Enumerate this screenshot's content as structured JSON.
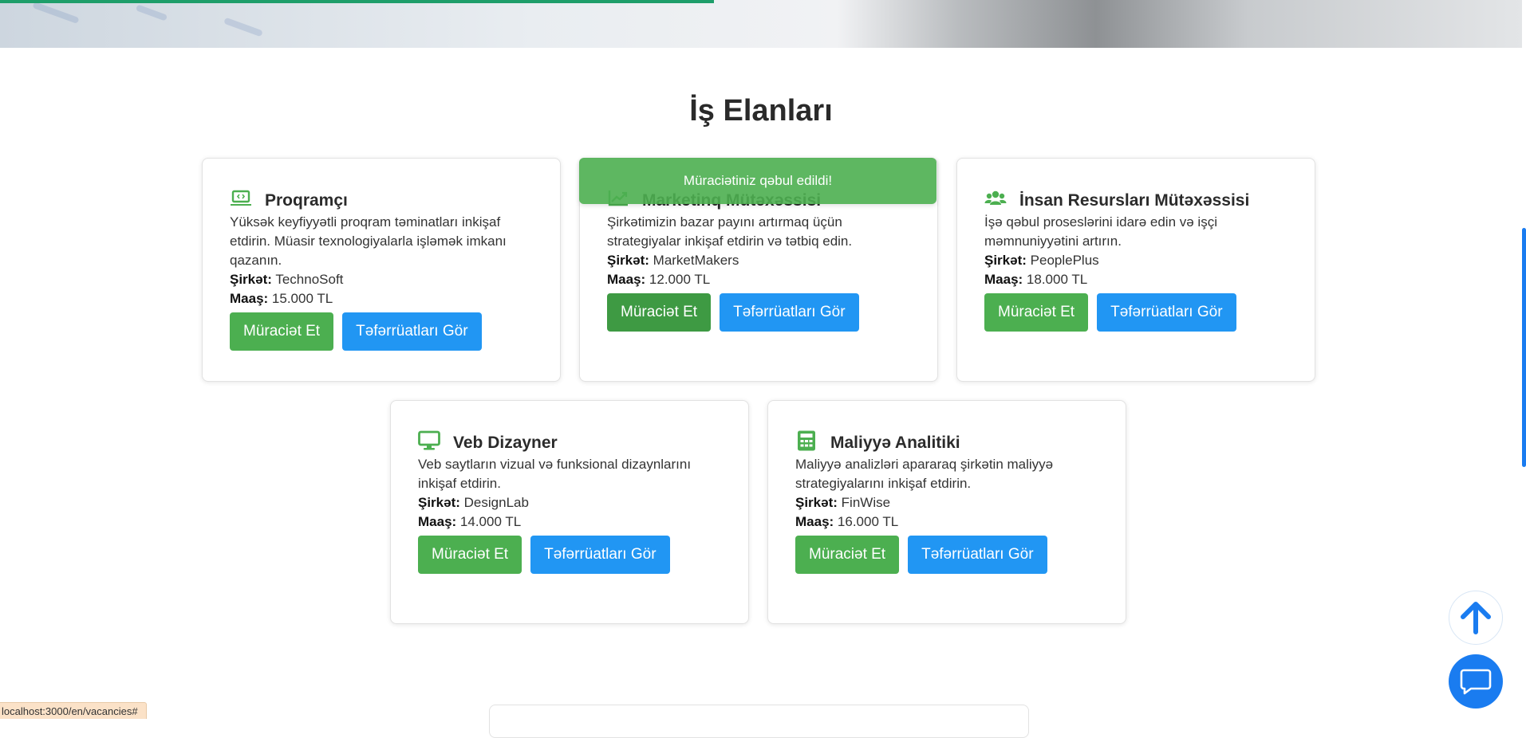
{
  "section": {
    "title": "İş Elanları"
  },
  "toast": {
    "message": "Müraciətiniz qəbul edildi!"
  },
  "labels": {
    "company": "Şirkət:",
    "salary": "Maaş:"
  },
  "buttons": {
    "apply": "Müraciət Et",
    "details": "Təfərrüatları Gör"
  },
  "jobs": [
    {
      "icon": "laptop-code-icon",
      "title": "Proqramçı",
      "description": "Yüksək keyfiyyətli proqram təminatları inkişaf etdirin. Müasir texnologiyalarla işləmək imkanı qazanın.",
      "company": "TechnoSoft",
      "salary": "15.000 TL"
    },
    {
      "icon": "chart-line-icon",
      "title": "Marketinq Mütəxəssisi",
      "description": "Şirkətimizin bazar payını artırmaq üçün strategiyalar inkişaf etdirin və tətbiq edin.",
      "company": "MarketMakers",
      "salary": "12.000 TL"
    },
    {
      "icon": "users-icon",
      "title": "İnsan Resursları Mütəxəssisi",
      "description": "İşə qəbul proseslərini idarə edin və işçi məmnuniyyətini artırın.",
      "company": "PeoplePlus",
      "salary": "18.000 TL"
    },
    {
      "icon": "desktop-icon",
      "title": "Veb Dizayner",
      "description": "Veb saytların vizual və funksional dizaynlarını inkişaf etdirin.",
      "company": "DesignLab",
      "salary": "14.000 TL"
    },
    {
      "icon": "calculator-icon",
      "title": "Maliyyə Analitiki",
      "description": "Maliyyə analizləri apararaq şirkətin maliyyə strategiyalarını inkişaf etdirin.",
      "company": "FinWise",
      "salary": "16.000 TL"
    }
  ],
  "status_bar": {
    "url": "localhost:3000/en/vacancies#"
  },
  "colors": {
    "accent_green": "#4caf50",
    "accent_blue": "#2196f3",
    "fab_blue": "#1a7cf0"
  }
}
